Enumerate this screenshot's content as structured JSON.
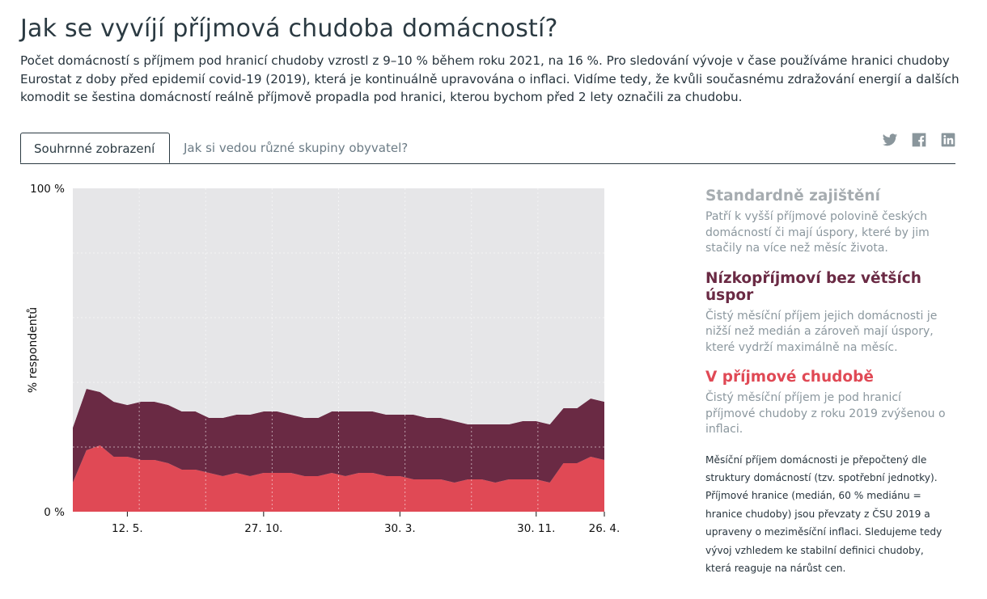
{
  "title": "Jak se vyvíjí příjmová chudoba domácností?",
  "intro": "Počet domácností s příjmem pod hranicí chudoby vzrostl z 9–10 % během roku 2021, na 16 %. Pro sledování vývoje v čase používáme hranici chudoby Eurostat z doby před epidemií covid-19 (2019), která je kontinuálně upravována o inflaci. Vidíme tedy, že kvůli současnému zdražování energií a dalších komodit se šestina domácností reálně příjmově propadla pod hranici, kterou bychom před 2 lety označili za chudobu.",
  "tabs": [
    {
      "label": "Souhrnné zobrazení",
      "active": true
    },
    {
      "label": "Jak si vedou různé skupiny obyvatel?",
      "active": false
    }
  ],
  "share": [
    {
      "icon": "twitter-icon"
    },
    {
      "icon": "facebook-icon"
    },
    {
      "icon": "linkedin-icon"
    }
  ],
  "legend": [
    {
      "title": "Standardně zajištění",
      "desc": "Patří k vyšší příjmové polovině českých domácností či mají úspory, které by jim stačily na více než měsíc života.",
      "color": "#e6e6e8"
    },
    {
      "title": "Nízkopříjmoví bez větších úspor",
      "desc": "Čistý měsíční příjem jejich domácnosti je nižší než medián a zároveň mají úspory, které vydrží maximálně na měsíc.",
      "color": "#6a2a44"
    },
    {
      "title": "V příjmové chudobě",
      "desc": "Čistý měsíční příjem je pod hranicí příjmové chudoby z roku 2019 zvýšenou o inflaci.",
      "color": "#e04955"
    }
  ],
  "note": "Měsíční příjem domácnosti je přepočtený dle struktury domácností (tzv. spotřební jednotky). Příjmové hranice (medián, 60 % mediánu = hranice chudoby) jsou převzaty z ČSU 2019 a upraveny o meziměsíční inflaci. Sledujeme tedy vývoj vzhledem ke stabilní definici chudoby, která reaguje na nárůst cen.",
  "chart_data": {
    "type": "area",
    "stacked": true,
    "ylabel": "% respondentů",
    "ylim": [
      0,
      100
    ],
    "yticks": [
      "0 %",
      "100 %"
    ],
    "grid": true,
    "x_tick_labels": [
      {
        "index": 4,
        "label": "12. 5."
      },
      {
        "index": 14,
        "label": "27. 10."
      },
      {
        "index": 24,
        "label": "30. 3."
      },
      {
        "index": 34,
        "label": "30. 11."
      },
      {
        "index": 39,
        "label": "26. 4."
      }
    ],
    "series": [
      {
        "name": "V příjmové chudobě",
        "color": "#e04955",
        "values": [
          9,
          19,
          20.5,
          17,
          17,
          16,
          16,
          15,
          13,
          13,
          12,
          11,
          12,
          11,
          12,
          12,
          12,
          11,
          11,
          12,
          11,
          12,
          12,
          11,
          11,
          10,
          10,
          10,
          9,
          10,
          10,
          9,
          10,
          10,
          10,
          9,
          15,
          15,
          17,
          16
        ]
      },
      {
        "name": "Nízkopříjmoví bez větších úspor",
        "color": "#6a2a44",
        "values": [
          17,
          19,
          16.5,
          17,
          16,
          18,
          18,
          18,
          18,
          18,
          17,
          18,
          18,
          19,
          19,
          19,
          18,
          18,
          18,
          19,
          20,
          19,
          19,
          19,
          19,
          20,
          19,
          19,
          19,
          17,
          17,
          18,
          17,
          18,
          18,
          18,
          17,
          17,
          18,
          18
        ]
      },
      {
        "name": "Standardně zajištění",
        "color": "#e6e6e8",
        "values": [
          74,
          62,
          63,
          66,
          67,
          66,
          66,
          67,
          69,
          69,
          71,
          71,
          70,
          70,
          69,
          69,
          70,
          71,
          71,
          69,
          69,
          69,
          69,
          70,
          70,
          70,
          71,
          71,
          72,
          73,
          73,
          73,
          73,
          72,
          72,
          73,
          68,
          68,
          65,
          66
        ]
      }
    ]
  }
}
